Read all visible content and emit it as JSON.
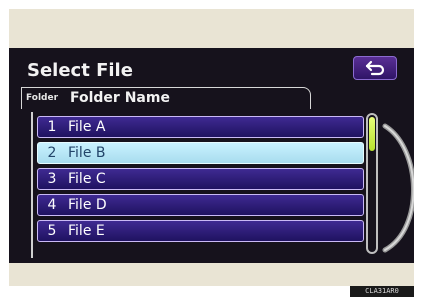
{
  "header": {
    "title": "Select File"
  },
  "folder": {
    "caption": "Folder",
    "name": "Folder Name"
  },
  "files": [
    {
      "num": "1",
      "label": "File A",
      "selected": false
    },
    {
      "num": "2",
      "label": "File B",
      "selected": true
    },
    {
      "num": "3",
      "label": "File C",
      "selected": false
    },
    {
      "num": "4",
      "label": "File D",
      "selected": false
    },
    {
      "num": "5",
      "label": "File E",
      "selected": false
    }
  ],
  "footer": {
    "code": "CLA31AR0"
  },
  "colors": {
    "item": "#3f2a92",
    "selected_item": "#a8dcee",
    "scroll_thumb": "#c8ef44"
  },
  "icons": {
    "back": "return-arrow-icon"
  }
}
